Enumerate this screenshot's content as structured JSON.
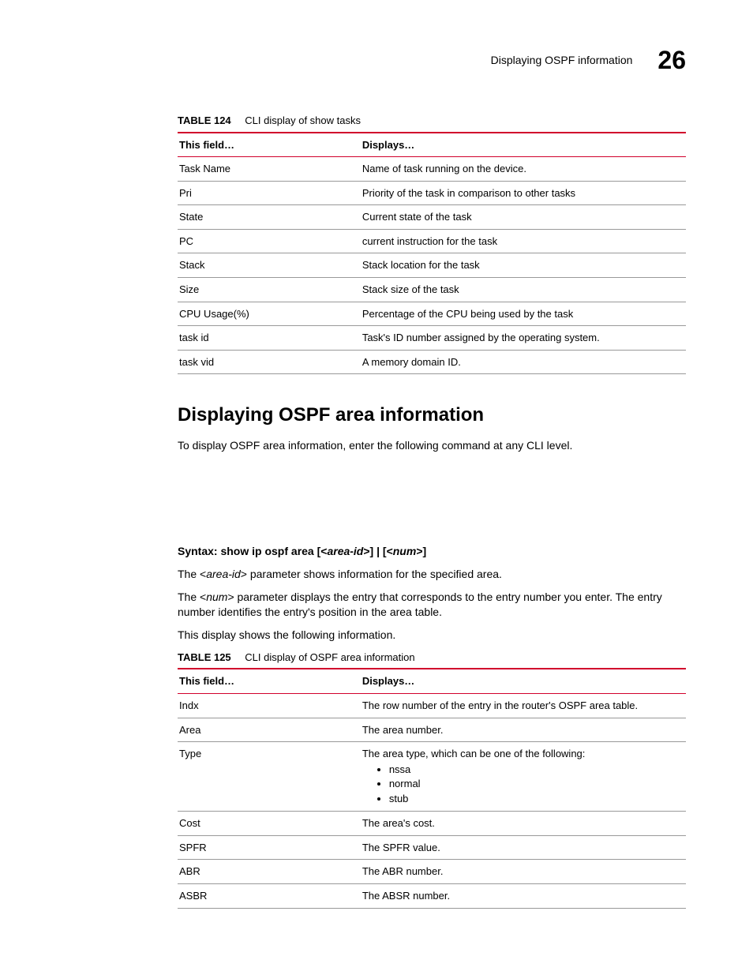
{
  "header": {
    "section": "Displaying OSPF information",
    "chapter": "26"
  },
  "table124": {
    "label": "TABLE 124",
    "title": "CLI display of show tasks",
    "head_field": "This field…",
    "head_disp": "Displays…",
    "rows": [
      {
        "f": "Task Name",
        "d": "Name of task running on the device."
      },
      {
        "f": "Pri",
        "d": "Priority of the task in comparison to other tasks"
      },
      {
        "f": "State",
        "d": "Current state of the task"
      },
      {
        "f": "PC",
        "d": "current instruction for the task"
      },
      {
        "f": "Stack",
        "d": "Stack location for the task"
      },
      {
        "f": "Size",
        "d": "Stack size of the task"
      },
      {
        "f": "CPU Usage(%)",
        "d": "Percentage of the CPU being used by the task"
      },
      {
        "f": "task id",
        "d": "Task's ID number assigned by the operating system."
      },
      {
        "f": "task vid",
        "d": "A memory domain ID."
      }
    ]
  },
  "section": {
    "heading": "Displaying OSPF area information",
    "intro": "To display OSPF area information, enter the following command at any CLI level.",
    "syntax_label": "Syntax:",
    "syntax_cmd": "show ip ospf area",
    "syntax_arg1a": " [<",
    "syntax_arg1b": "area-id",
    "syntax_arg1c": ">] | [<",
    "syntax_arg2": "num",
    "syntax_arg2c": ">]",
    "p_area_id_a": "The <",
    "p_area_id_b": "area-id",
    "p_area_id_c": "> parameter shows information for the specified area.",
    "p_num_a": "The <",
    "p_num_b": "num",
    "p_num_c": "> parameter displays the entry that corresponds to the entry number you enter. The entry number identifies the entry's position in the area table.",
    "p_display_info": "This display shows the following information."
  },
  "table125": {
    "label": "TABLE 125",
    "title": "CLI display of OSPF area information",
    "head_field": "This field…",
    "head_disp": "Displays…",
    "rows": [
      {
        "f": "Indx",
        "d": "The row number of the entry in the router's OSPF area table."
      },
      {
        "f": "Area",
        "d": "The area number."
      }
    ],
    "type_row": {
      "f": "Type",
      "d": "The area type, which can be one of the following:",
      "b1": "nssa",
      "b2": "normal",
      "b3": "stub"
    },
    "rows2": [
      {
        "f": "Cost",
        "d": "The area's cost."
      },
      {
        "f": "SPFR",
        "d": "The SPFR value."
      },
      {
        "f": "ABR",
        "d": "The ABR number."
      },
      {
        "f": "ASBR",
        "d": "The ABSR number."
      }
    ]
  }
}
